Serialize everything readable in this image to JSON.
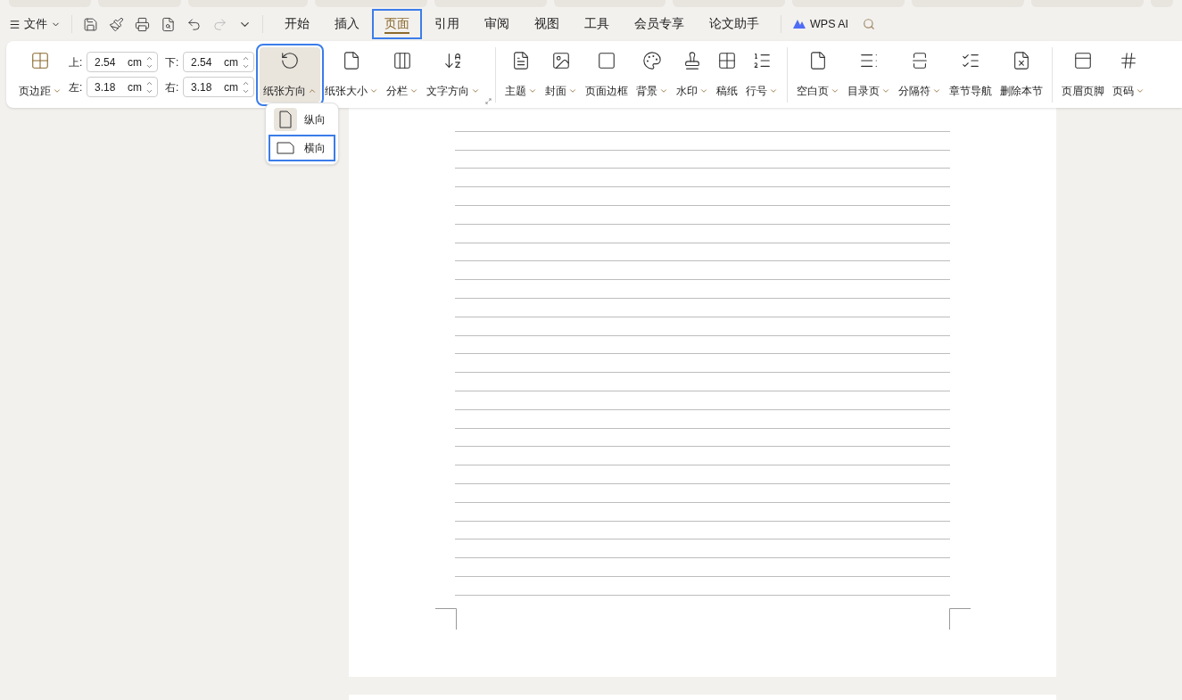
{
  "menu_bar": {
    "file_menu": "文件",
    "tabs": [
      {
        "label": "开始",
        "selected": false,
        "highlighted": false
      },
      {
        "label": "插入",
        "selected": false,
        "highlighted": false
      },
      {
        "label": "页面",
        "selected": true,
        "highlighted": true
      },
      {
        "label": "引用",
        "selected": false,
        "highlighted": false
      },
      {
        "label": "审阅",
        "selected": false,
        "highlighted": false
      },
      {
        "label": "视图",
        "selected": false,
        "highlighted": false
      },
      {
        "label": "工具",
        "selected": false,
        "highlighted": false
      },
      {
        "label": "会员专享",
        "selected": false,
        "highlighted": false
      },
      {
        "label": "论文助手",
        "selected": false,
        "highlighted": false
      }
    ],
    "ai_button": "WPS AI"
  },
  "ribbon": {
    "margins": {
      "label": "页边距",
      "fields": [
        {
          "label": "上:",
          "value": "2.54",
          "unit": "cm"
        },
        {
          "label": "下:",
          "value": "2.54",
          "unit": "cm"
        },
        {
          "label": "左:",
          "value": "3.18",
          "unit": "cm"
        },
        {
          "label": "右:",
          "value": "3.18",
          "unit": "cm"
        }
      ]
    },
    "groups": [
      {
        "items": [
          {
            "label": "纸张方向",
            "kind": "dropdown",
            "expanded": true,
            "pressed": true,
            "highlighted": true
          },
          {
            "label": "纸张大小",
            "kind": "dropdown",
            "expanded": false,
            "pressed": false,
            "highlighted": false
          },
          {
            "label": "分栏",
            "kind": "dropdown",
            "expanded": false,
            "pressed": false,
            "highlighted": false
          },
          {
            "label": "文字方向",
            "kind": "dropdown",
            "expanded": false,
            "pressed": false,
            "highlighted": false
          }
        ]
      },
      {
        "items": [
          {
            "label": "主题",
            "kind": "dropdown",
            "expanded": false,
            "pressed": false,
            "highlighted": false
          },
          {
            "label": "封面",
            "kind": "dropdown",
            "expanded": false,
            "pressed": false,
            "highlighted": false
          },
          {
            "label": "页面边框",
            "kind": "button",
            "pressed": false,
            "highlighted": false
          },
          {
            "label": "背景",
            "kind": "dropdown",
            "expanded": false,
            "pressed": false,
            "highlighted": false
          },
          {
            "label": "水印",
            "kind": "dropdown",
            "expanded": false,
            "pressed": false,
            "highlighted": false
          },
          {
            "label": "稿纸",
            "kind": "button",
            "pressed": false,
            "highlighted": false
          },
          {
            "label": "行号",
            "kind": "dropdown",
            "expanded": false,
            "pressed": false,
            "highlighted": false
          }
        ]
      },
      {
        "items": [
          {
            "label": "空白页",
            "kind": "dropdown",
            "expanded": false,
            "pressed": false,
            "highlighted": false
          },
          {
            "label": "目录页",
            "kind": "dropdown",
            "expanded": false,
            "pressed": false,
            "highlighted": false
          },
          {
            "label": "分隔符",
            "kind": "dropdown",
            "expanded": false,
            "pressed": false,
            "highlighted": false
          },
          {
            "label": "章节导航",
            "kind": "button",
            "pressed": false,
            "highlighted": false
          },
          {
            "label": "删除本节",
            "kind": "button",
            "pressed": false,
            "highlighted": false
          }
        ]
      },
      {
        "items": [
          {
            "label": "页眉页脚",
            "kind": "button",
            "pressed": false,
            "highlighted": false
          },
          {
            "label": "页码",
            "kind": "dropdown",
            "expanded": false,
            "pressed": false,
            "highlighted": false
          }
        ]
      }
    ]
  },
  "orientation_menu": [
    {
      "label": "纵向",
      "selected": true,
      "highlighted": false
    },
    {
      "label": "横向",
      "selected": false,
      "highlighted": true
    }
  ]
}
